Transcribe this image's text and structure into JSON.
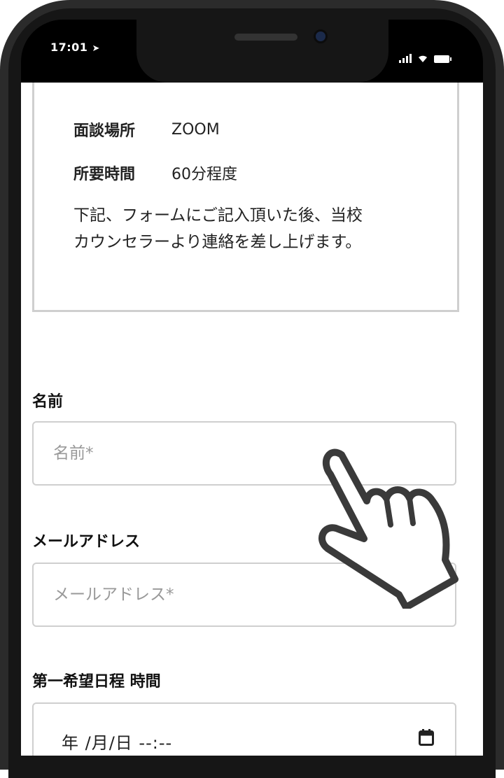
{
  "status_bar": {
    "time": "17:01",
    "icons": [
      "location-arrow-icon",
      "signal-icon",
      "wifi-icon",
      "battery-icon"
    ]
  },
  "info": {
    "location_label": "面談場所",
    "location_value": "ZOOM",
    "duration_label": "所要時間",
    "duration_value": "60分程度",
    "description_line1": "下記、フォームにご記入頂いた後、当校",
    "description_line2": "カウンセラーより連絡を差し上げます。"
  },
  "form": {
    "name_label": "名前",
    "name_placeholder": "名前*",
    "email_label": "メールアドレス",
    "email_placeholder": "メールアドレス*",
    "date_label": "第一希望日程 時間",
    "date_value": "年 /月/日 --:--"
  },
  "colors": {
    "frame": "#2b2b2b",
    "border": "#cfcfcf",
    "text": "#222222",
    "placeholder": "#999999"
  }
}
